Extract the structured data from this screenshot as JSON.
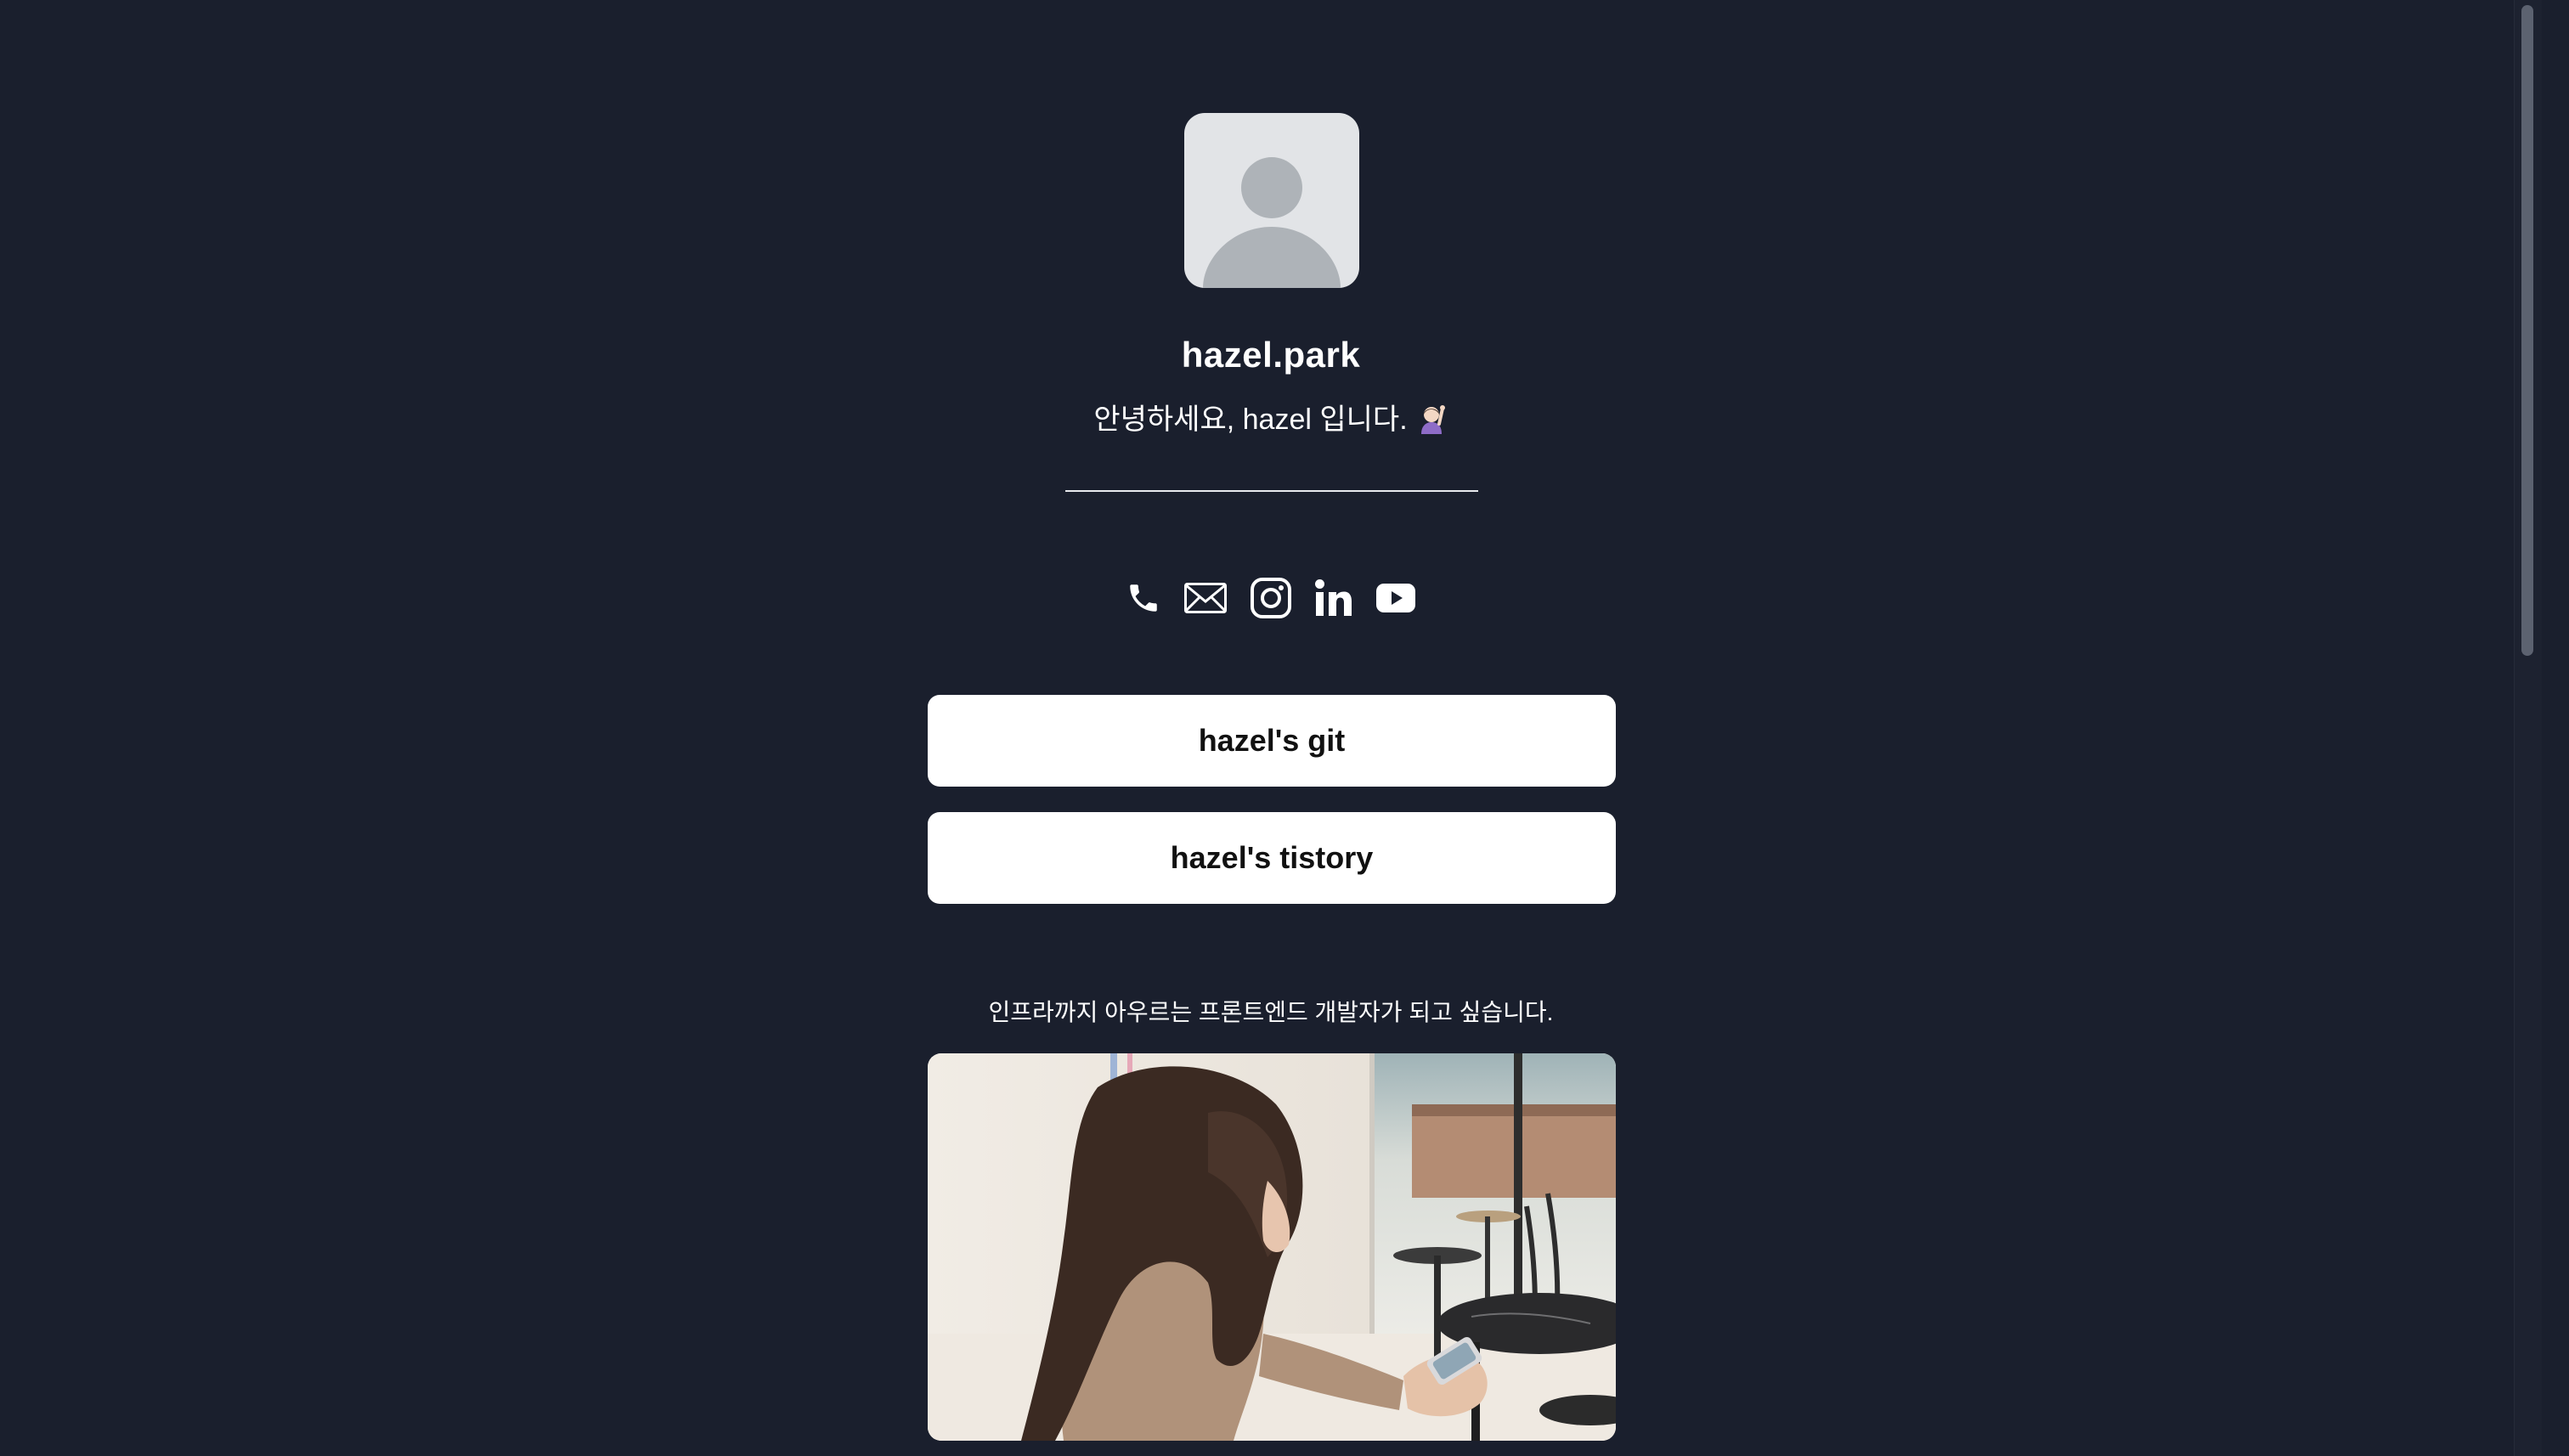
{
  "profile": {
    "avatar_icon": "person-silhouette-icon",
    "username": "hazel.park",
    "greeting": "안녕하세요, hazel 입니다.",
    "greeting_emoji_icon": "woman-raising-hand-emoji-icon"
  },
  "socials": [
    {
      "name": "phone",
      "icon": "phone-icon"
    },
    {
      "name": "email",
      "icon": "mail-icon"
    },
    {
      "name": "instagram",
      "icon": "instagram-icon"
    },
    {
      "name": "linkedin",
      "icon": "linkedin-icon"
    },
    {
      "name": "youtube",
      "icon": "youtube-icon"
    }
  ],
  "links": {
    "git_label": "hazel's git",
    "tistory_label": "hazel's tistory"
  },
  "about": {
    "tagline": "인프라까지 아우르는 프론트엔드 개발자가 되고 싶습니다.",
    "photo": "photo-of-person-in-cafe"
  },
  "colors": {
    "background": "#1a1f2d",
    "button_bg": "#ffffff",
    "button_text": "#111111",
    "avatar_bg": "#e2e4e7",
    "avatar_silhouette": "#aeb3b8"
  }
}
